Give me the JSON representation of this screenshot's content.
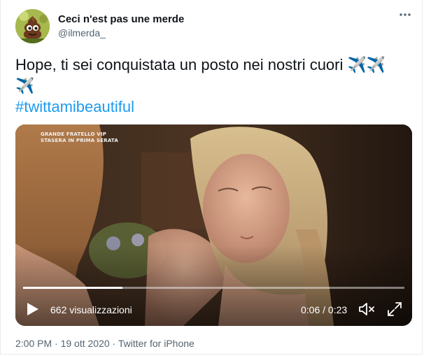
{
  "user": {
    "display_name": "Ceci n'est pas une merde",
    "handle": "@ilmerda_"
  },
  "tweet": {
    "text": "Hope, ti sei conquistata un posto nei nostri cuori ",
    "emoji_line1": "✈️✈️",
    "emoji_line2": "✈️",
    "hashtag": "#twittamibeautiful"
  },
  "video": {
    "watermark_line1": "GRANDE FRATELLO VIP",
    "watermark_line2": "STASERA IN PRIMA SERATA",
    "views": "662 visualizzazioni",
    "time": "0:06 / 0:23",
    "progress": 0.26
  },
  "footer": {
    "time": "2:00 PM",
    "date": "19 ott 2020",
    "separator": "·",
    "source": "Twitter for iPhone"
  },
  "icons": {
    "more": "more-icon",
    "play": "play-icon",
    "volume": "volume-icon",
    "fullscreen": "fullscreen-icon",
    "plane": "airplane-emoji"
  },
  "colors": {
    "hashtag": "#1d9bf0",
    "secondary_text": "#536471",
    "plane": "#7ab8e3"
  }
}
